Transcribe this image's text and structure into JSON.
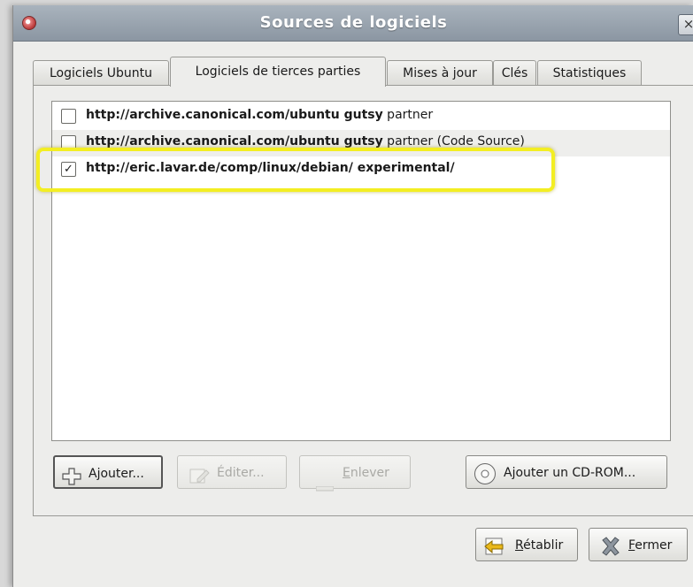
{
  "window": {
    "title": "Sources de logiciels",
    "close_glyph": "×"
  },
  "tabs": [
    {
      "label": "Logiciels Ubuntu",
      "active": false
    },
    {
      "label": "Logiciels de tierces parties",
      "active": true
    },
    {
      "label": "Mises à jour",
      "active": false
    },
    {
      "label": "Clés",
      "active": false
    },
    {
      "label": "Statistiques",
      "active": false
    }
  ],
  "sources": [
    {
      "checked": false,
      "url": "http://archive.canonical.com/ubuntu gutsy",
      "suffix": " partner",
      "mark": ""
    },
    {
      "checked": false,
      "url": "http://archive.canonical.com/ubuntu gutsy",
      "suffix": " partner (Code Source)",
      "mark": ""
    },
    {
      "checked": true,
      "url": "http://eric.lavar.de/comp/linux/debian/ experimental/",
      "suffix": "",
      "mark": "✓"
    }
  ],
  "panel_buttons": {
    "add": "Ajouter...",
    "edit": "Éditer...",
    "remove_prefix": "",
    "remove_mnemonic": "E",
    "remove_rest": "nlever",
    "add_cdrom": "Ajouter un CD-ROM..."
  },
  "footer_buttons": {
    "revert_mnemonic": "R",
    "revert_rest": "établir",
    "close_mnemonic": "F",
    "close_rest": "ermer"
  },
  "icons": {
    "app": "software-sources-icon",
    "add": "plus-icon",
    "edit": "edit-icon",
    "remove": "minus-icon",
    "cdrom": "cdrom-icon",
    "revert": "revert-icon",
    "close": "close-x-icon"
  },
  "colors": {
    "highlight": "#f3ee22",
    "titlebar": "#9aa4af"
  }
}
